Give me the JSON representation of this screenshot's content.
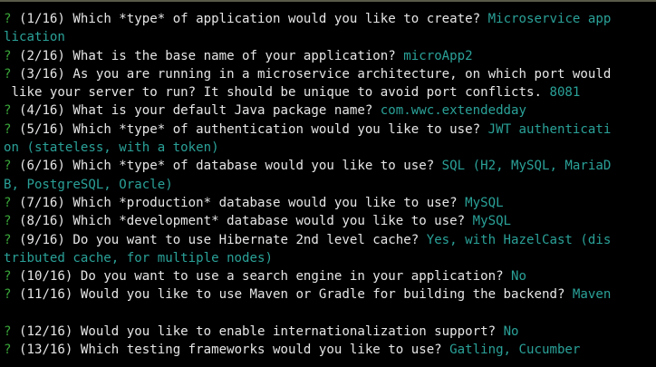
{
  "colors": {
    "background": "#000000",
    "question_mark": "#3aa63a",
    "question_text": "#e6e6e6",
    "answer_text": "#2aa198"
  },
  "prompt_marker": "?",
  "lines": [
    {
      "kind": "first",
      "question": " (1/16) Which *type* of application would you like to create? ",
      "answer": "Microservice app"
    },
    {
      "kind": "cont",
      "question": "",
      "answer": "lication"
    },
    {
      "kind": "first",
      "question": " (2/16) What is the base name of your application? ",
      "answer": "microApp2"
    },
    {
      "kind": "first",
      "question": " (3/16) As you are running in a microservice architecture, on which port would",
      "answer": ""
    },
    {
      "kind": "cont",
      "question": " like your server to run? It should be unique to avoid port conflicts. ",
      "answer": "8081"
    },
    {
      "kind": "first",
      "question": " (4/16) What is your default Java package name? ",
      "answer": "com.wwc.extendedday"
    },
    {
      "kind": "first",
      "question": " (5/16) Which *type* of authentication would you like to use? ",
      "answer": "JWT authenticati"
    },
    {
      "kind": "cont",
      "question": "",
      "answer": "on (stateless, with a token)"
    },
    {
      "kind": "first",
      "question": " (6/16) Which *type* of database would you like to use? ",
      "answer": "SQL (H2, MySQL, MariaD"
    },
    {
      "kind": "cont",
      "question": "",
      "answer": "B, PostgreSQL, Oracle)"
    },
    {
      "kind": "first",
      "question": " (7/16) Which *production* database would you like to use? ",
      "answer": "MySQL"
    },
    {
      "kind": "first",
      "question": " (8/16) Which *development* database would you like to use? ",
      "answer": "MySQL"
    },
    {
      "kind": "first",
      "question": " (9/16) Do you want to use Hibernate 2nd level cache? ",
      "answer": "Yes, with HazelCast (dis"
    },
    {
      "kind": "cont",
      "question": "",
      "answer": "tributed cache, for multiple nodes)"
    },
    {
      "kind": "first",
      "question": " (10/16) Do you want to use a search engine in your application? ",
      "answer": "No"
    },
    {
      "kind": "first",
      "question": " (11/16) Would you like to use Maven or Gradle for building the backend? ",
      "answer": "Maven"
    },
    {
      "kind": "blank",
      "question": "",
      "answer": ""
    },
    {
      "kind": "first",
      "question": " (12/16) Would you like to enable internationalization support? ",
      "answer": "No"
    },
    {
      "kind": "first",
      "question": " (13/16) Which testing frameworks would you like to use? ",
      "answer": "Gatling, Cucumber"
    }
  ]
}
